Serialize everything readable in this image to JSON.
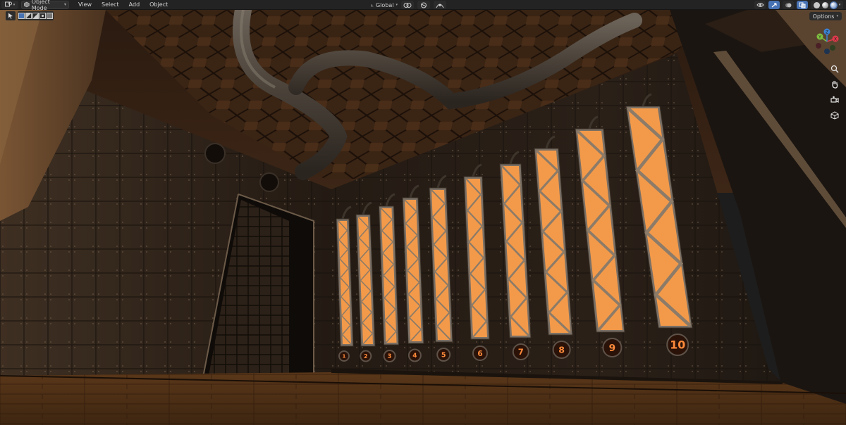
{
  "header": {
    "mode": "Object Mode",
    "menu": [
      "View",
      "Select",
      "Add",
      "Object"
    ],
    "orientation": "Global",
    "icons": [
      "editor-type-icon",
      "select-box-icon",
      "transform-orientation-icon",
      "pivot-icon",
      "snap-icon",
      "proportional-edit-icon",
      "viewport-gizmo-icon",
      "overlay-icon",
      "xray-icon",
      "shading-solid-icon",
      "shading-material-icon",
      "shading-rendered-icon"
    ]
  },
  "viewport": {
    "options_label": "Options",
    "gizmo_axes": [
      "X",
      "Y",
      "Z"
    ],
    "nav_icons": [
      "zoom-icon",
      "hand-pan-icon",
      "camera-view-icon",
      "grid-ortho-icon"
    ]
  },
  "scene": {
    "tube_numbers": [
      "1",
      "2",
      "3",
      "4",
      "5",
      "6",
      "7",
      "8",
      "9",
      "10"
    ]
  },
  "colors": {
    "ui_bg": "#232323",
    "accent_blue": "#4772b3",
    "tube_glow": "#f39a4a",
    "axis_x": "#e0394b",
    "axis_y": "#7fbf3f",
    "axis_z": "#3b82d6"
  }
}
